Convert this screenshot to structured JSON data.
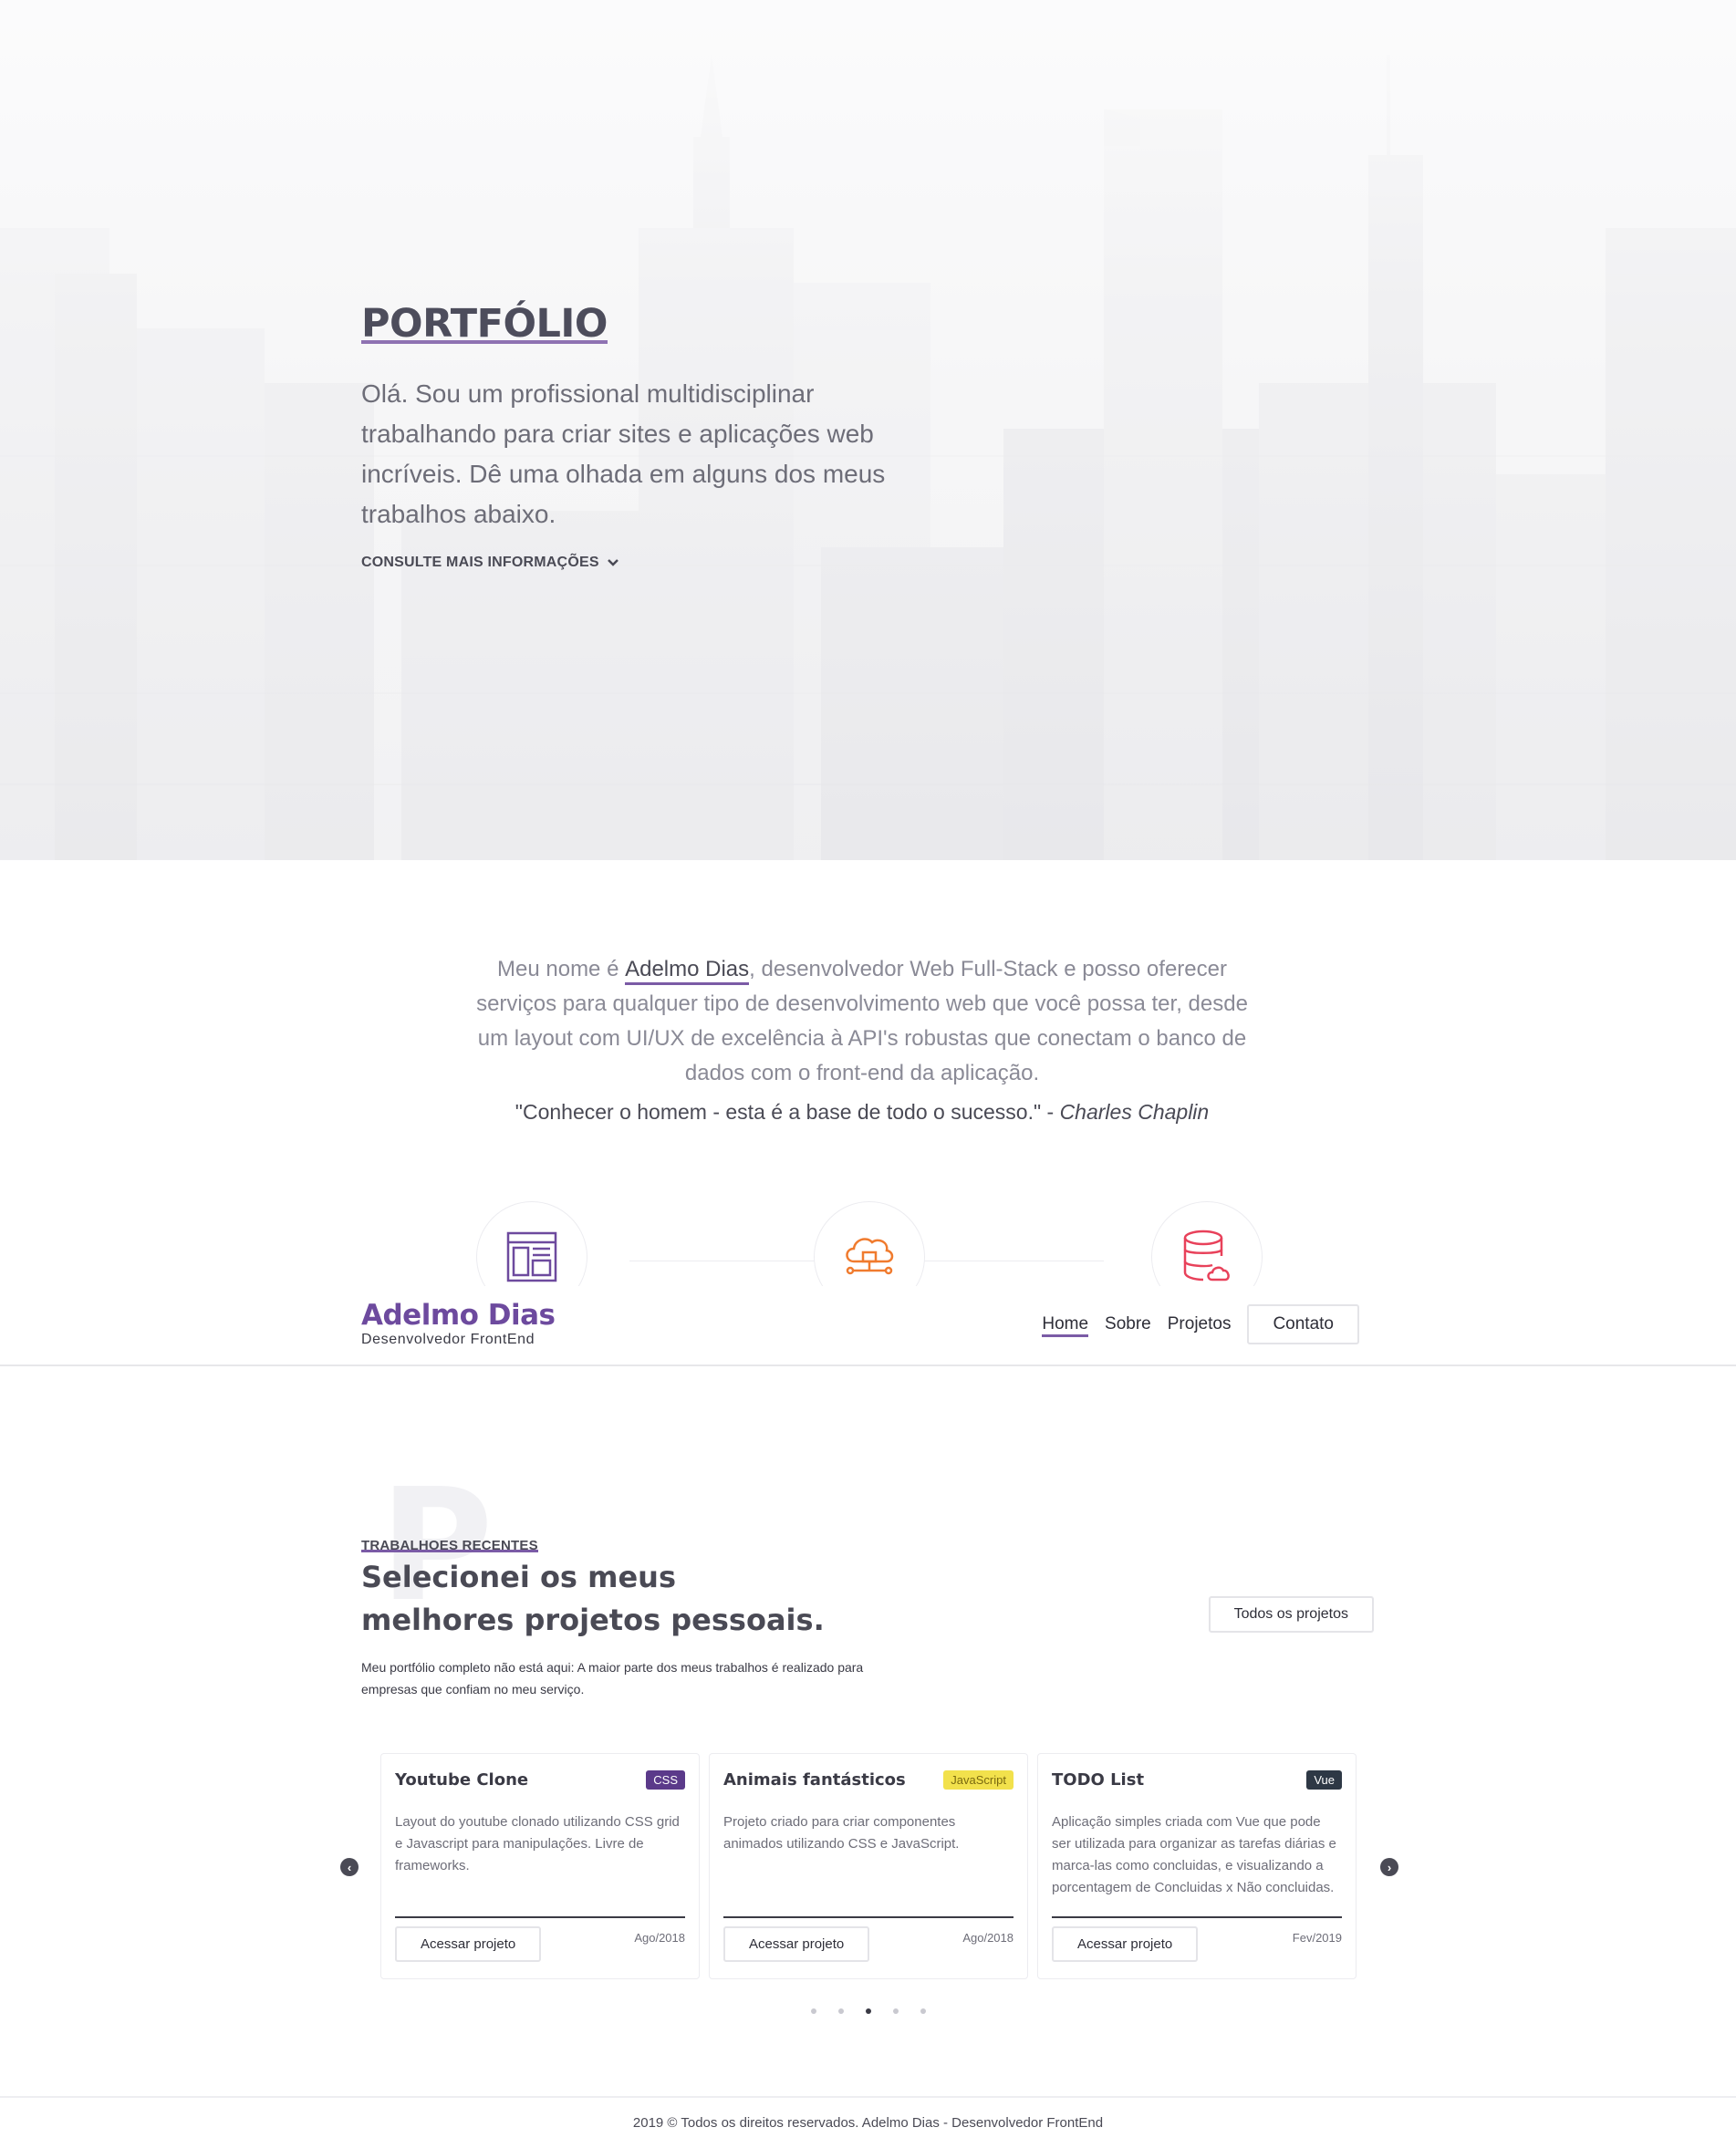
{
  "hero": {
    "title": "PORTFÓLIO",
    "text": "Olá. Sou um profissional multidisciplinar trabalhando para criar sites e aplicações web incríveis. Dê uma olhada em alguns dos meus trabalhos abaixo.",
    "more_link": "CONSULTE MAIS INFORMAÇÕES"
  },
  "about": {
    "text_before": "Meu nome é ",
    "name": "Adelmo Dias",
    "text_after": ", desenvolvedor Web Full-Stack e posso oferecer serviços para qualquer tipo de desenvolvimento web que você possa ter, desde um layout com UI/UX de excelência à API's robustas que conectam o banco de dados com o front-end da aplicação.",
    "quote": "\"Conhecer o homem - esta é a base de todo o sucesso.\" - ",
    "quote_author": "Charles Chaplin"
  },
  "services": [
    {
      "icon": "layout-icon",
      "color": "#6d4a9e"
    },
    {
      "icon": "cloud-network-icon",
      "color": "#f07b2e"
    },
    {
      "icon": "database-cloud-icon",
      "color": "#e8415a"
    }
  ],
  "navbar": {
    "brand_name": "Adelmo Dias",
    "brand_sub": "Desenvolvedor FrontEnd",
    "links": [
      "Home",
      "Sobre",
      "Projetos"
    ],
    "contact": "Contato"
  },
  "works": {
    "big_letter": "P",
    "eyebrow": "TRABALHOES RECENTES",
    "title": "Selecionei os meus melhores projetos pessoais.",
    "description": "Meu portfólio completo não está aqui: A maior parte dos meus trabalhos é realizado para empresas que confiam no meu serviço.",
    "all_button": "Todos os projetos"
  },
  "projects": [
    {
      "title": "Youtube Clone",
      "tag": "CSS",
      "tag_bg": "#5b3a8a",
      "tag_color": "#ffffff",
      "desc": "Layout do youtube clonado utilizando CSS grid e Javascript para manipulações. Livre de frameworks.",
      "button": "Acessar projeto",
      "date": "Ago/2018"
    },
    {
      "title": "Animais fantásticos",
      "tag": "JavaScript",
      "tag_bg": "#f2e14c",
      "tag_color": "#7a6a10",
      "desc": "Projeto criado para criar componentes animados utilizando CSS e JavaScript.",
      "button": "Acessar projeto",
      "date": "Ago/2018"
    },
    {
      "title": "TODO List",
      "tag": "Vue",
      "tag_bg": "#2e3845",
      "tag_color": "#ffffff",
      "desc": "Aplicação simples criada com Vue que pode ser utilizada para organizar as tarefas diárias e marca-las como concluidas, e visualizando a porcentagem de Concluidas x Não concluidas.",
      "button": "Acessar projeto",
      "date": "Fev/2019"
    }
  ],
  "carousel": {
    "prev": "‹",
    "next": "›",
    "dot_count": 5,
    "active_dot": 3
  },
  "footer": {
    "text": "2019 © Todos os direitos reservados. Adelmo Dias - Desenvolvedor FrontEnd"
  }
}
